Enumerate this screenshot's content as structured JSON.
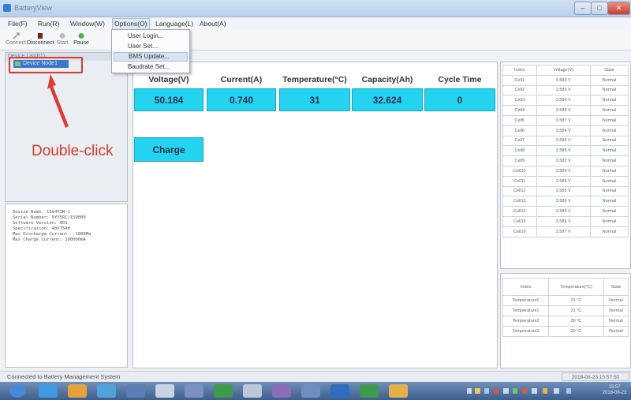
{
  "window": {
    "title": "BatteryView"
  },
  "menu": [
    "File(F)",
    "Run(R)",
    "Window(W)",
    "Options(O)",
    "Language(L)",
    "About(A)"
  ],
  "toolbar": [
    "Connect",
    "Disconnect",
    "Start",
    "Pause"
  ],
  "dropdown": [
    "User Login...",
    "User Set...",
    "BMS Update...",
    "Baudrate Set..."
  ],
  "tree": {
    "header": "Device List(F1)",
    "node": "Device Node1"
  },
  "annotation": {
    "label": "Double-click"
  },
  "info_lines": [
    "Device Name: 15&4TSM-1",
    "Serial Number: 9YY5RC/150000",
    "Software Version: 001",
    "Specification: 48V75AH",
    "Max Discharge Current: -1000Ma",
    "Max Charge Current: 100000mA"
  ],
  "measurements": [
    {
      "label": "Voltage(V)",
      "value": "50.184"
    },
    {
      "label": "Current(A)",
      "value": "0.740"
    },
    {
      "label": "Temperature(°C)",
      "value": "31"
    },
    {
      "label": "Capacity(Ah)",
      "value": "32.624"
    },
    {
      "label": "Cycle Time",
      "value": "0"
    }
  ],
  "charge_button": "Charge",
  "cell_table": {
    "headers": [
      "Index",
      "Voltage(V)",
      "State"
    ],
    "rows": [
      [
        "Cell1",
        "3.583 V",
        "Normal"
      ],
      [
        "Cell2",
        "3.585 V",
        "Normal"
      ],
      [
        "Cell3",
        "3.586 V",
        "Normal"
      ],
      [
        "Cell4",
        "3.585 V",
        "Normal"
      ],
      [
        "Cell5",
        "3.587 V",
        "Normal"
      ],
      [
        "Cell6",
        "3.584 V",
        "Normal"
      ],
      [
        "Cell7",
        "3.585 V",
        "Normal"
      ],
      [
        "Cell8",
        "3.585 V",
        "Normal"
      ],
      [
        "Cell9",
        "3.582 V",
        "Normal"
      ],
      [
        "Cell10",
        "3.584 V",
        "Normal"
      ],
      [
        "Cell11",
        "3.585 V",
        "Normal"
      ],
      [
        "Cell12",
        "3.585 V",
        "Normal"
      ],
      [
        "Cell13",
        "3.586 V",
        "Normal"
      ],
      [
        "Cell14",
        "3.585 V",
        "Normal"
      ],
      [
        "Cell15",
        "3.585 V",
        "Normal"
      ],
      [
        "Cell16",
        "3.587 V",
        "Normal"
      ]
    ]
  },
  "temp_table": {
    "headers": [
      "Index",
      "Temperature(°C)",
      "State"
    ],
    "rows": [
      [
        "Temperature0",
        "31 °C",
        "Normal"
      ],
      [
        "Temperature1",
        "31 °C",
        "Normal"
      ],
      [
        "Temperature2",
        "30 °C",
        "Normal"
      ],
      [
        "Temperature3",
        "30 °C",
        "Normal"
      ]
    ]
  },
  "status": {
    "text": "Connected to Battery Management System",
    "time": "2018-08-23 15:57:50"
  },
  "colors": {
    "value_box": "#23d3ef",
    "annotation": "#d93a2b",
    "tree_selected": "#3c78c8"
  },
  "taskbar_icons": [
    "start-orb-icon",
    "ie-icon",
    "media-icon",
    "chrome-icon",
    "app-icon",
    "paint-icon",
    "tool-icon",
    "excel-icon",
    "files-icon",
    "settings-icon",
    "window-icon",
    "word-icon",
    "sheet-icon",
    "photo-icon"
  ],
  "clock": {
    "time": "15:57",
    "date": "2018-08-23"
  }
}
